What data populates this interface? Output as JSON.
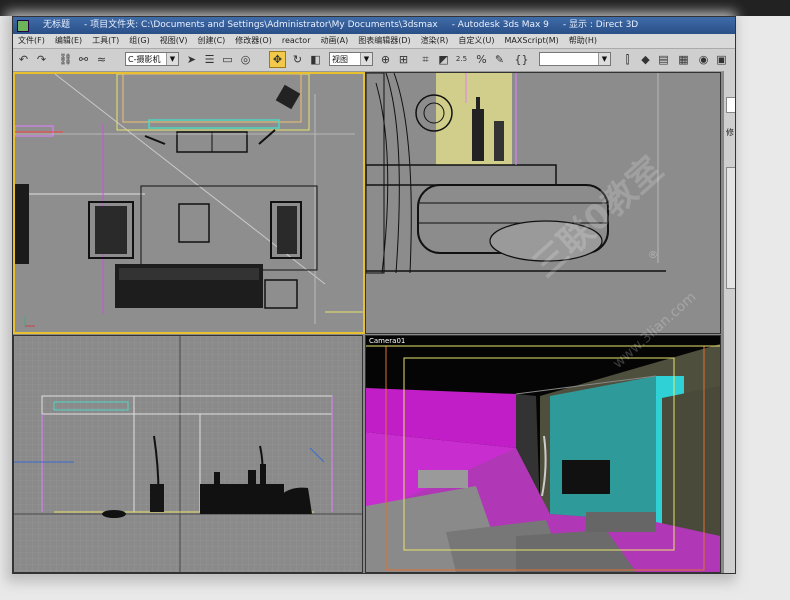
{
  "window": {
    "icon_label": "无标题",
    "title_project": "- 项目文件夹: C:\\Documents and Settings\\Administrator\\My Documents\\3dsmax",
    "title_app": "- Autodesk 3ds Max 9",
    "title_display": "- 显示 : Direct 3D"
  },
  "menu": [
    "文件(F)",
    "编辑(E)",
    "工具(T)",
    "组(G)",
    "视图(V)",
    "创建(C)",
    "修改器(O)",
    "reactor",
    "动画(A)",
    "图表编辑器(D)",
    "渲染(R)",
    "自定义(U)",
    "MAXScript(M)",
    "帮助(H)"
  ],
  "toolbar": {
    "selection_set_value": "C-摄影机",
    "reference_coord_value": "视图",
    "snap_value": "2.5",
    "named_set_value": ""
  },
  "viewports": {
    "camera_label": "Camera01"
  },
  "command_panel": {
    "label": "修"
  },
  "watermark": {
    "text": "三联0教室",
    "url": "www.3lian.com",
    "registered": "®"
  }
}
